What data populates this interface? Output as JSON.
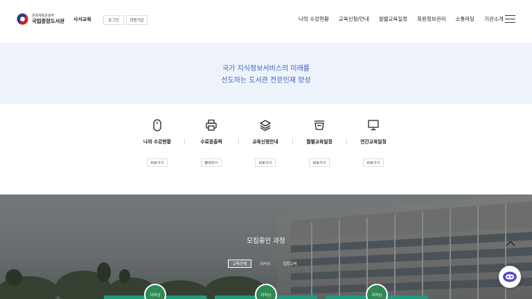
{
  "header": {
    "logo_small": "문화체육관광부",
    "logo_big": "국립중앙도서관",
    "subsite": "사서교육",
    "login_label": "로그인",
    "join_label": "회원가입",
    "nav": [
      "나의 수강현황",
      "교육신청/안내",
      "월별교육일정",
      "회원정보관리",
      "소통마당",
      "기관소개"
    ],
    "menu_icon": "hamburger-menu-icon"
  },
  "hero": {
    "line1": "국가 지식정보서비스의 미래를",
    "line2": "선도하는 도서관 전문인재 양성",
    "accent_color": "#3f63bd",
    "background": "#eef2fb"
  },
  "quick_menu": [
    {
      "icon": "mouse-icon",
      "label": "나의 수강현황",
      "button": "바로가기"
    },
    {
      "icon": "printer-icon",
      "label": "수료증출력",
      "button": "출력하기"
    },
    {
      "icon": "layers-icon",
      "label": "교육신청안내",
      "button": "바로가기"
    },
    {
      "icon": "calendar-basket-icon",
      "label": "월별교육일정",
      "button": "바로가기"
    },
    {
      "icon": "monitor-icon",
      "label": "연간교육일정",
      "button": "바로가기"
    }
  ],
  "recruit": {
    "title": "모집중인 과정",
    "tabs": [
      "교육전체",
      "이러닝",
      "집합교육"
    ],
    "badges": [
      "이러닝",
      "이러닝",
      "이러닝"
    ],
    "card_color": "#1f9c7d",
    "badge_color": "#2e8a52"
  },
  "floating": {
    "scroll_top_icon": "chevron-up-icon",
    "chatbot_icon": "chatbot-icon"
  }
}
